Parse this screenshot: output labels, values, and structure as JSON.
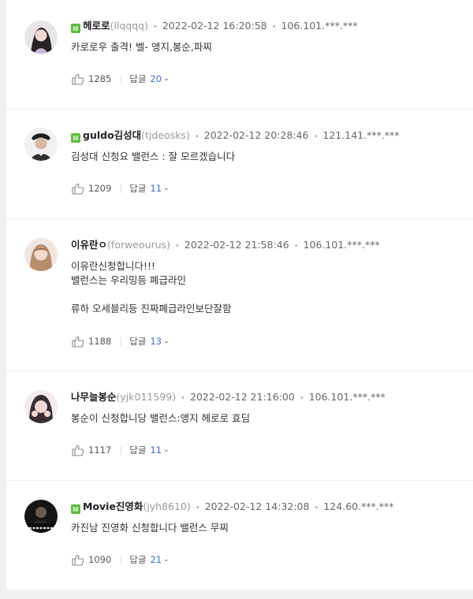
{
  "badge_icon": "comment-badge",
  "reply_label": "답글",
  "colors": {
    "badge": "#5dbb3b",
    "reply_count": "#3b6fce",
    "background": "#f0f0f0"
  },
  "comments": [
    {
      "nickname": "헤로로",
      "user_id": "(llqqqq)",
      "date": "2022-02-12 16:20:58",
      "ip": "106.101.***.***",
      "lines": [
        "카로로우 출격! 벨- 앵지,봉순,파찌"
      ],
      "likes": "1285",
      "replies": "20"
    },
    {
      "nickname": "guldo김성대",
      "user_id": "(tjdeosks)",
      "date": "2022-02-12 20:28:46",
      "ip": "121.141.***.***",
      "lines": [
        "김성대 신청요 밸런스 : 잘 모르겠습니다"
      ],
      "likes": "1209",
      "replies": "11"
    },
    {
      "nickname": "이유란ㅇ",
      "user_id": "(forweourus)",
      "date": "2022-02-12 21:58:46",
      "ip": "106.101.***.***",
      "lines": [
        "이유란신청합니다!!!",
        "밸런스는 우리밍등 폐급라인",
        "",
        "류하 오세블리등 진짜폐급라인보단잘함"
      ],
      "likes": "1188",
      "replies": "13"
    },
    {
      "nickname": "나무늘봉순",
      "user_id": "(yjk011599)",
      "date": "2022-02-12 21:16:00",
      "ip": "106.101.***.***",
      "lines": [
        "봉순이 신청합니당 밸런스:앵지 헤로로 효딤"
      ],
      "likes": "1117",
      "replies": "11"
    },
    {
      "nickname": "Movie진영화",
      "user_id": "(jyh8610)",
      "date": "2022-02-12 14:32:08",
      "ip": "124.60.***.***",
      "lines": [
        "카진남 진영화 신청합니다 밸런스 무찌"
      ],
      "likes": "1090",
      "replies": "21"
    }
  ]
}
